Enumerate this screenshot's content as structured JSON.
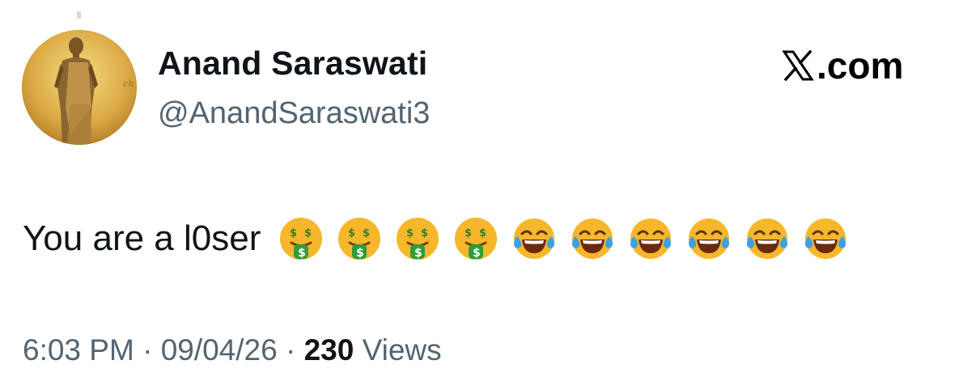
{
  "author": {
    "display_name": "Anand Saraswati",
    "handle": "@AnandSaraswati3",
    "avatar_icon": "statue-portrait-avatar"
  },
  "brand": {
    "icon": "x-logo-icon",
    "text": ".com"
  },
  "tweet": {
    "text": "You are a l0ser",
    "emojis": [
      "money-mouth-face",
      "money-mouth-face",
      "money-mouth-face",
      "money-mouth-face",
      "face-with-tears-of-joy",
      "face-with-tears-of-joy",
      "face-with-tears-of-joy",
      "face-with-tears-of-joy",
      "face-with-tears-of-joy",
      "face-with-tears-of-joy"
    ]
  },
  "meta": {
    "time": "6:03 PM",
    "separator": "·",
    "date": "09/04/26",
    "views_count": "230",
    "views_label": "Views"
  },
  "colors": {
    "primary_text": "#0f1419",
    "secondary_text": "#536471",
    "emoji_yellow": "#f7b72b",
    "emoji_green": "#2e9c3a",
    "tear_blue": "#3ba0e6"
  }
}
